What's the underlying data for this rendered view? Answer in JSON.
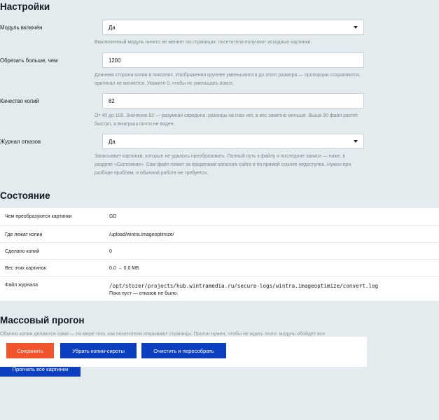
{
  "settings": {
    "heading": "Настройки",
    "module": {
      "label": "Модуль включён",
      "value": "Да",
      "hint": "Выключенный модуль ничего не меняет на страницах: посетители получают исходные картинки."
    },
    "resize": {
      "label": "Обрезать больше, чем",
      "value": "1200",
      "hint": "Длинная сторона копии в пикселях. Изображения крупнее уменьшаются до этого размера — пропорции сохраняются, оригинал не меняется. Укажите 0, чтобы не уменьшать вовсе."
    },
    "quality": {
      "label": "Качество копий",
      "value": "82",
      "hint": "От 40 до 100. Значение 82 — разумная середина: разницы на глаз нет, а вес заметно меньше. Выше 90 файл растёт быстро, а выигрыш почти не виден."
    },
    "log": {
      "label": "Журнал отказов",
      "value": "Да",
      "hint": "Записывает картинки, которые не удалось преобразовать. Полный путь к файлу и последние записи — ниже, в разделе «Состояние». Сам файл лежит за пределами каталога сайта и по прямой ссылке недоступен. Нужен при разборе проблем, в обычной работе не требуется."
    }
  },
  "status": {
    "heading": "Состояние",
    "rows": [
      {
        "key": "Чем преобразуются картинки",
        "value": "GD"
      },
      {
        "key": "Где лежат копии",
        "value": "/upload/wintra.imageoptimize/"
      },
      {
        "key": "Сделано копий",
        "value": "0"
      },
      {
        "key": "Вес этих картинок",
        "value": "0.0 → 0.0 МБ"
      },
      {
        "key": "Файл журнала",
        "value": "/opt/stozer/projects/hub.wintramedia.ru/secure-logs/wintra.imageoptimize/convert.log",
        "note": "Пока пуст — отказов не было."
      }
    ]
  },
  "bulk": {
    "heading": "Массовый прогон",
    "desc": "Обычно копии делаются сами — по мере того, как посетители открывают страницы. Прогон нужен, чтобы не ждать этого: модуль обойдёт все",
    "run_label": "Прогнать все картинки"
  },
  "actions": {
    "save": "Сохранить",
    "remove_orphans": "Убрать копии-сироты",
    "clear_rebuild": "Очистить и пересобрать"
  },
  "colors": {
    "background": "#e3ebef",
    "primary": "#0b3fbf",
    "accent": "#f2542d"
  }
}
